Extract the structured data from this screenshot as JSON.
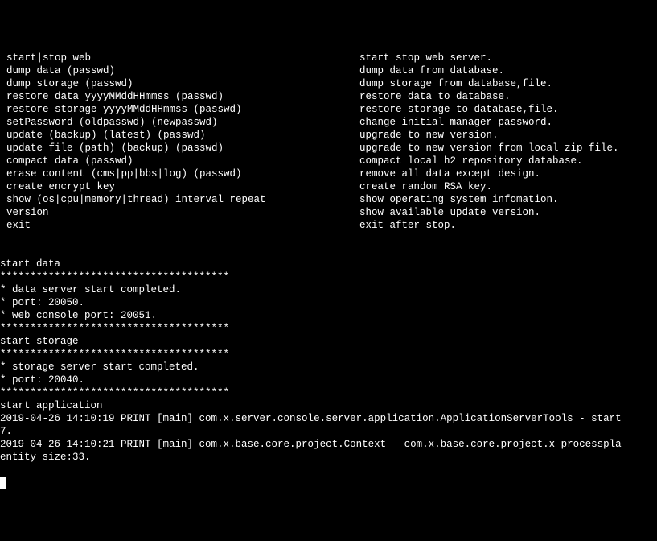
{
  "help": [
    {
      "cmd": "start|stop web",
      "desc": "start stop web server."
    },
    {
      "cmd": "dump data (passwd)",
      "desc": "dump data from database."
    },
    {
      "cmd": "dump storage (passwd)",
      "desc": "dump storage from database,file."
    },
    {
      "cmd": "restore data yyyyMMddHHmmss (passwd)",
      "desc": "restore data to database."
    },
    {
      "cmd": "restore storage yyyyMMddHHmmss (passwd)",
      "desc": "restore storage to database,file."
    },
    {
      "cmd": "setPassword (oldpasswd) (newpasswd)",
      "desc": "change initial manager password."
    },
    {
      "cmd": "update (backup) (latest) (passwd)",
      "desc": "upgrade to new version."
    },
    {
      "cmd": "update file (path) (backup) (passwd)",
      "desc": "upgrade to new version from local zip file."
    },
    {
      "cmd": "compact data (passwd)",
      "desc": "compact local h2 repository database."
    },
    {
      "cmd": "erase content (cms|pp|bbs|log) (passwd)",
      "desc": "remove all data except design."
    },
    {
      "cmd": "create encrypt key",
      "desc": "create random RSA key."
    },
    {
      "cmd": "show (os|cpu|memory|thread) interval repeat",
      "desc": "show operating system infomation."
    },
    {
      "cmd": "version",
      "desc": "show available update version."
    },
    {
      "cmd": "exit",
      "desc": "exit after stop."
    }
  ],
  "log": [
    "",
    "start data",
    "**************************************",
    "* data server start completed.",
    "* port: 20050.",
    "* web console port: 20051.",
    "**************************************",
    "start storage",
    "**************************************",
    "* storage server start completed.",
    "* port: 20040.",
    "**************************************",
    "start application",
    "2019-04-26 14:10:19 PRINT [main] com.x.server.console.server.application.ApplicationServerTools - start",
    "7.",
    "2019-04-26 14:10:21 PRINT [main] com.x.base.core.project.Context - com.x.base.core.project.x_processpla",
    "entity size:33."
  ]
}
